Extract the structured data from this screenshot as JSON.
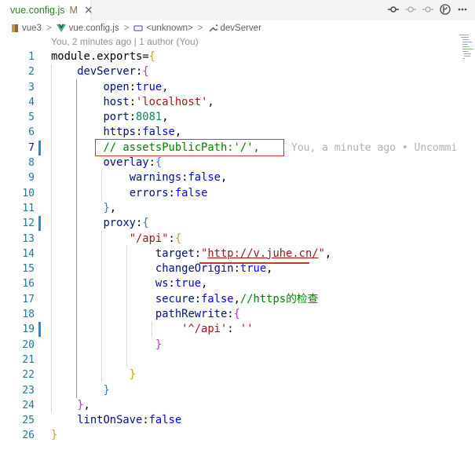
{
  "tab": {
    "file_name": "vue.config.js",
    "modified_marker": "M",
    "close": "×"
  },
  "icons": {
    "vue": "vue-icon",
    "close": "close-icon",
    "actions": [
      "git-compare-icon",
      "go-back-icon",
      "go-forward-icon",
      "timeline-icon",
      "more-icon"
    ]
  },
  "breadcrumb": {
    "folder": "vue3",
    "file": "vue.config.js",
    "symbol1": "<unknown>",
    "symbol2": "devServer",
    "sep": ">"
  },
  "codelens": "You, 2 minutes ago | 1 author (You)",
  "blame": "You, a minute ago • Uncommi",
  "lines": [
    {
      "n": "1",
      "parts": [
        [
          "module",
          "k"
        ],
        [
          ".",
          "k"
        ],
        [
          "exports",
          "k"
        ],
        [
          "=",
          "k"
        ],
        [
          "{",
          "br1"
        ]
      ]
    },
    {
      "n": "2",
      "parts": [
        [
          "    ",
          ""
        ],
        [
          "devServer",
          "key"
        ],
        [
          ":",
          "k"
        ],
        [
          "{",
          "br2"
        ]
      ]
    },
    {
      "n": "3",
      "parts": [
        [
          "        ",
          ""
        ],
        [
          "open",
          "key"
        ],
        [
          ":",
          "k"
        ],
        [
          "true",
          "kw"
        ],
        [
          ",",
          "k"
        ]
      ]
    },
    {
      "n": "4",
      "parts": [
        [
          "        ",
          ""
        ],
        [
          "host",
          "key"
        ],
        [
          ":",
          "k"
        ],
        [
          "'localhost'",
          "str"
        ],
        [
          ",",
          "k"
        ]
      ]
    },
    {
      "n": "5",
      "parts": [
        [
          "        ",
          ""
        ],
        [
          "port",
          "key"
        ],
        [
          ":",
          "k"
        ],
        [
          "8081",
          "num"
        ],
        [
          ",",
          "k"
        ]
      ]
    },
    {
      "n": "6",
      "parts": [
        [
          "        ",
          ""
        ],
        [
          "https",
          "key"
        ],
        [
          ":",
          "k"
        ],
        [
          "false",
          "kw"
        ],
        [
          ",",
          "k"
        ]
      ]
    },
    {
      "n": "7",
      "parts": [
        [
          "        ",
          ""
        ],
        [
          "// assetsPublicPath:'/',",
          "cm"
        ]
      ]
    },
    {
      "n": "8",
      "parts": [
        [
          "        ",
          ""
        ],
        [
          "overlay",
          "key"
        ],
        [
          ":",
          "k"
        ],
        [
          "{",
          "br3"
        ]
      ]
    },
    {
      "n": "9",
      "parts": [
        [
          "            ",
          ""
        ],
        [
          "warnings",
          "key"
        ],
        [
          ":",
          "k"
        ],
        [
          "false",
          "kw"
        ],
        [
          ",",
          "k"
        ]
      ]
    },
    {
      "n": "10",
      "parts": [
        [
          "            ",
          ""
        ],
        [
          "errors",
          "key"
        ],
        [
          ":",
          "k"
        ],
        [
          "false",
          "kw"
        ]
      ]
    },
    {
      "n": "11",
      "parts": [
        [
          "        ",
          ""
        ],
        [
          "}",
          "br3"
        ],
        [
          ",",
          "k"
        ]
      ]
    },
    {
      "n": "12",
      "parts": [
        [
          "        ",
          ""
        ],
        [
          "proxy",
          "key"
        ],
        [
          ":",
          "k"
        ],
        [
          "{",
          "br3"
        ]
      ]
    },
    {
      "n": "13",
      "parts": [
        [
          "            ",
          ""
        ],
        [
          "\"/api\"",
          "str"
        ],
        [
          ":",
          "k"
        ],
        [
          "{",
          "br1"
        ]
      ]
    },
    {
      "n": "14",
      "parts": [
        [
          "                ",
          ""
        ],
        [
          "target",
          "key"
        ],
        [
          ":",
          "k"
        ],
        [
          "\"",
          "str"
        ],
        [
          "http://v.juhe.cn/",
          "url"
        ],
        [
          "\"",
          "str"
        ],
        [
          ",",
          "k"
        ]
      ]
    },
    {
      "n": "15",
      "parts": [
        [
          "                ",
          ""
        ],
        [
          "changeOrigin",
          "key"
        ],
        [
          ":",
          "k"
        ],
        [
          "true",
          "kw"
        ],
        [
          ",",
          "k"
        ]
      ]
    },
    {
      "n": "16",
      "parts": [
        [
          "                ",
          ""
        ],
        [
          "ws",
          "key"
        ],
        [
          ":",
          "k"
        ],
        [
          "true",
          "kw"
        ],
        [
          ",",
          "k"
        ]
      ]
    },
    {
      "n": "17",
      "parts": [
        [
          "                ",
          ""
        ],
        [
          "secure",
          "key"
        ],
        [
          ":",
          "k"
        ],
        [
          "false",
          "kw"
        ],
        [
          ",",
          "k"
        ],
        [
          "//https的检查",
          "cm"
        ]
      ]
    },
    {
      "n": "18",
      "parts": [
        [
          "                ",
          ""
        ],
        [
          "pathRewrite",
          "key"
        ],
        [
          ":",
          "k"
        ],
        [
          "{",
          "br2"
        ]
      ]
    },
    {
      "n": "19",
      "parts": [
        [
          "                    ",
          ""
        ],
        [
          "'^/api'",
          "str"
        ],
        [
          ": ",
          "k"
        ],
        [
          "''",
          "str"
        ]
      ]
    },
    {
      "n": "20",
      "parts": [
        [
          "                ",
          ""
        ],
        [
          "}",
          "br2"
        ]
      ]
    },
    {
      "n": "21",
      "parts": []
    },
    {
      "n": "22",
      "parts": [
        [
          "            ",
          ""
        ],
        [
          "}",
          "br1"
        ]
      ]
    },
    {
      "n": "23",
      "parts": [
        [
          "        ",
          ""
        ],
        [
          "}",
          "br3"
        ]
      ]
    },
    {
      "n": "24",
      "parts": [
        [
          "    ",
          ""
        ],
        [
          "}",
          "br2"
        ],
        [
          ",",
          "k"
        ]
      ]
    },
    {
      "n": "25",
      "parts": [
        [
          "    ",
          ""
        ],
        [
          "lintOnSave",
          "key"
        ],
        [
          ":",
          "k"
        ],
        [
          "false",
          "kw"
        ]
      ]
    },
    {
      "n": "26",
      "parts": [
        [
          "}",
          "br1"
        ]
      ]
    }
  ],
  "active_line": "7",
  "colors": {
    "line_number": "#237893",
    "git_modified": "#1d8cea",
    "highlight_box": "#e03131",
    "string": "#a31515",
    "keyword": "#0000ff",
    "comment": "#008000"
  }
}
